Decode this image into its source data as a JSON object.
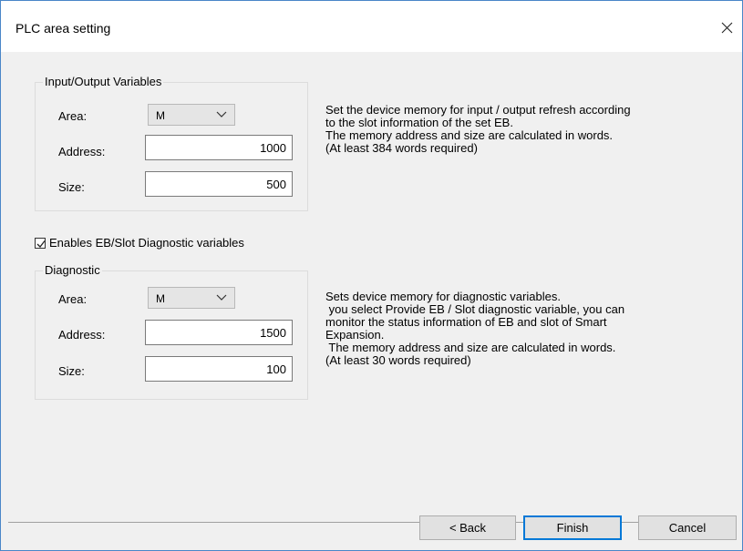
{
  "window": {
    "title": "PLC area setting"
  },
  "io_group": {
    "legend": "Input/Output Variables",
    "area_label": "Area:",
    "area_value": "M",
    "address_label": "Address:",
    "address_value": "1000",
    "size_label": "Size:",
    "size_value": "500",
    "description": "Set the device memory for input / output refresh according\nto the slot information of the set EB.\nThe memory address and size are calculated in words.\n(At least 384 words required)"
  },
  "diag_checkbox": {
    "label": "Enables EB/Slot Diagnostic variables",
    "checked": true
  },
  "diag_group": {
    "legend": "Diagnostic",
    "area_label": "Area:",
    "area_value": "M",
    "address_label": "Address:",
    "address_value": "1500",
    "size_label": "Size:",
    "size_value": "100",
    "description": "Sets device memory for diagnostic variables.\n you select Provide EB / Slot diagnostic variable, you can\nmonitor the status information of EB and slot of Smart\nExpansion.\n The memory address and size are calculated in words.\n(At least 30 words required)"
  },
  "buttons": {
    "back": "< Back",
    "finish": "Finish",
    "cancel": "Cancel"
  },
  "icons": {
    "close": "close-icon",
    "dropdown": "chevron-down-icon",
    "check": "checkmark-icon"
  },
  "colors": {
    "accent": "#0078d7",
    "window_border": "#4a86c8"
  }
}
